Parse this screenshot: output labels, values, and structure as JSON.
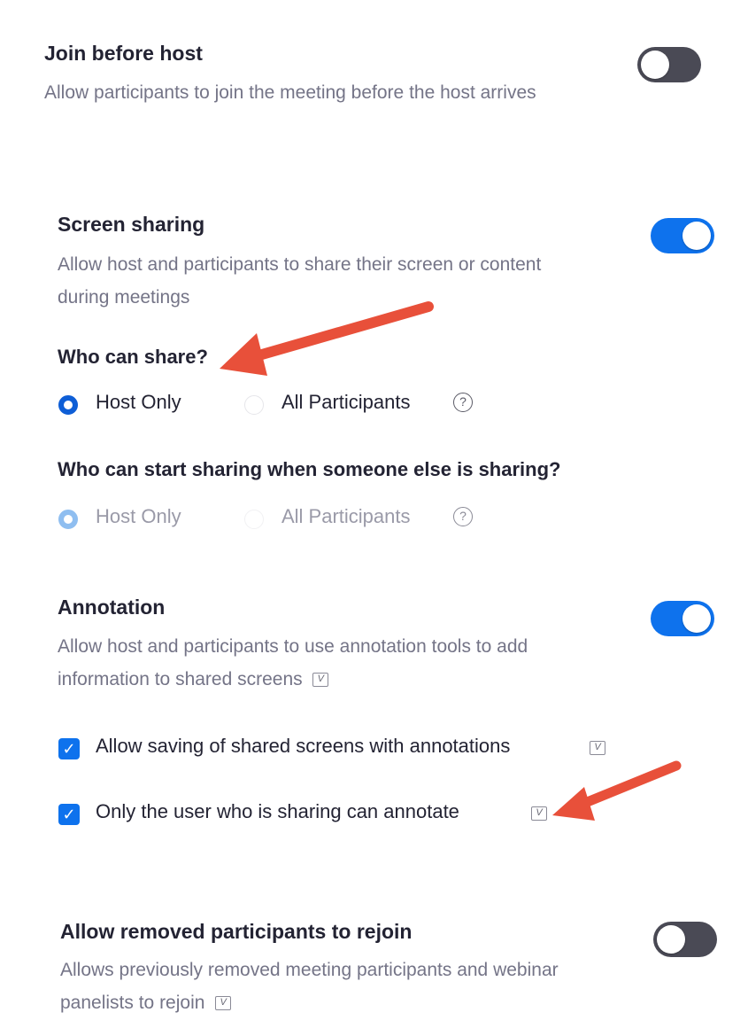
{
  "settings": {
    "join_before_host": {
      "title": "Join before host",
      "description": "Allow participants to join the meeting before the host arrives",
      "enabled": false
    },
    "screen_sharing": {
      "title": "Screen sharing",
      "description": "Allow host and participants to share their screen or content during meetings",
      "enabled": true,
      "who_can_share": {
        "label": "Who can share?",
        "options": [
          "Host Only",
          "All Participants"
        ],
        "selected": "Host Only"
      },
      "who_can_start": {
        "label": "Who can start sharing when someone else is sharing?",
        "options": [
          "Host Only",
          "All Participants"
        ],
        "selected": "Host Only"
      },
      "help_glyph": "?"
    },
    "annotation": {
      "title": "Annotation",
      "description": "Allow host and participants to use annotation tools to add information to shared screens",
      "enabled": true,
      "checkboxes": [
        {
          "label": "Allow saving of shared screens with annotations",
          "checked": true
        },
        {
          "label": "Only the user who is sharing can annotate",
          "checked": true
        }
      ]
    },
    "rejoin": {
      "title": "Allow removed participants to rejoin",
      "description": "Allows previously removed meeting participants and webinar panelists to rejoin",
      "enabled": false
    }
  },
  "icons": {
    "version_icon_glyph": "V",
    "check_glyph": "✓"
  },
  "colors": {
    "toggle_on": "#0e72ed",
    "toggle_off": "#4a4a55",
    "annotation_arrow": "#e8503a"
  }
}
